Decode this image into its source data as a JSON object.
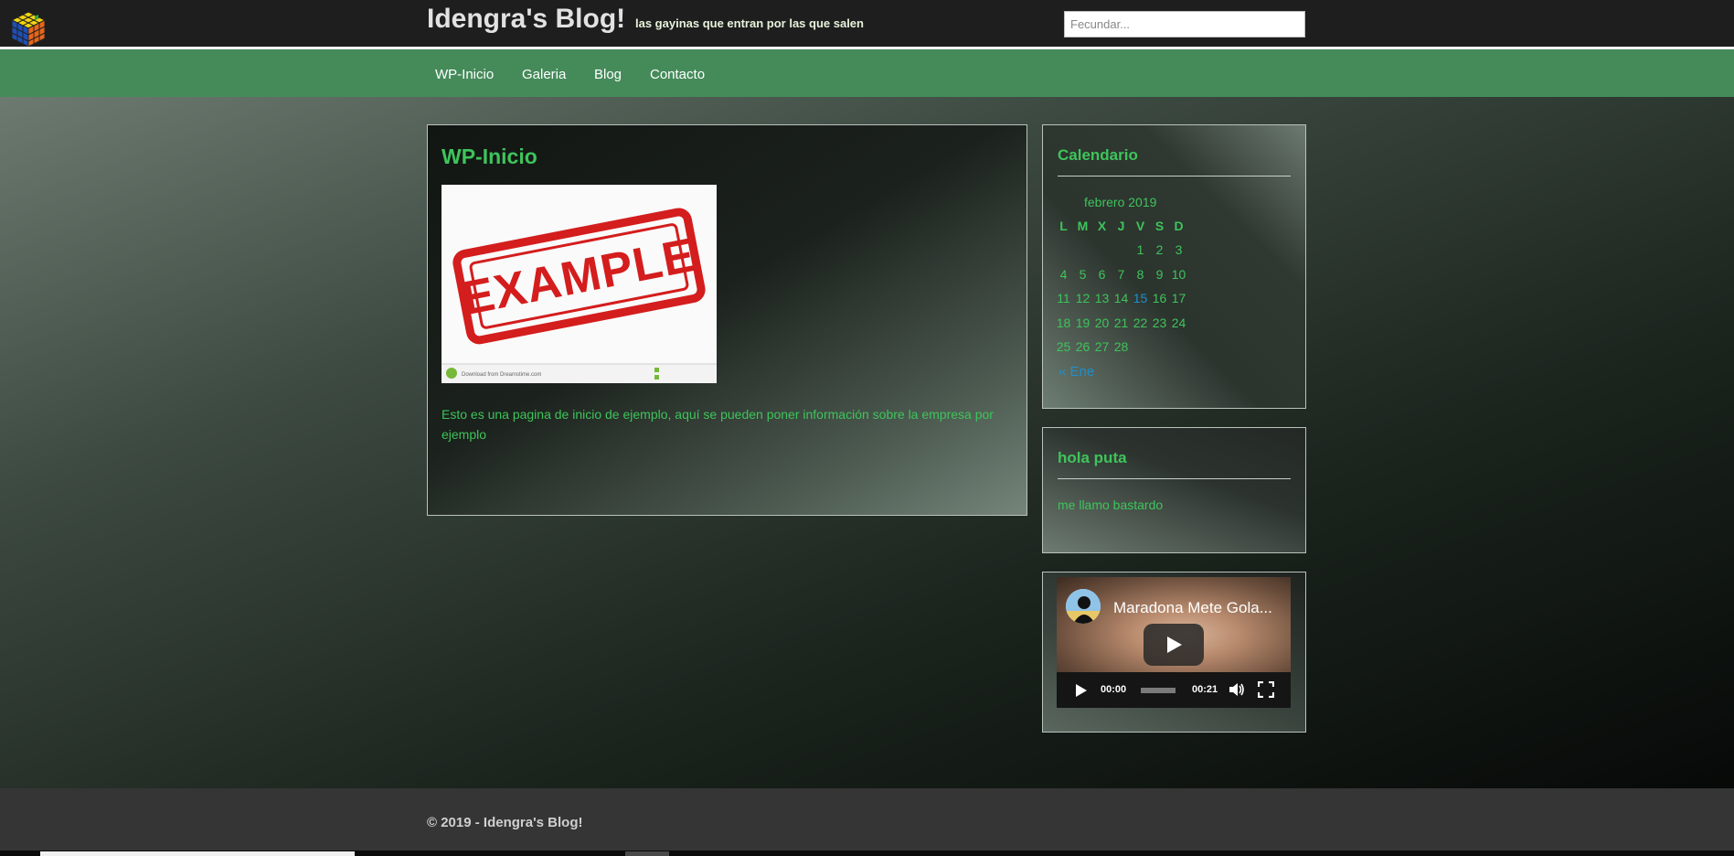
{
  "header": {
    "site_title": "Idengra's Blog!",
    "tagline": "las gayinas que entran por las que salen",
    "search_placeholder": "Fecundar..."
  },
  "nav": {
    "items": [
      "WP-Inicio",
      "Galeria",
      "Blog",
      "Contacto"
    ]
  },
  "main": {
    "title": "WP-Inicio",
    "image": {
      "stamp_text": "EXAMPLE",
      "watermark": "Download from Dreamstime.com"
    },
    "body_text": "Esto es una pagina de inicio de ejemplo, aquí se pueden poner información sobre la empresa por ejemplo"
  },
  "calendar_widget": {
    "title": "Calendario",
    "caption": "febrero 2019",
    "weekdays": [
      "L",
      "M",
      "X",
      "J",
      "V",
      "S",
      "D"
    ],
    "weeks": [
      [
        "",
        "",
        "",
        "",
        "1",
        "2",
        "3"
      ],
      [
        "4",
        "5",
        "6",
        "7",
        "8",
        "9",
        "10"
      ],
      [
        "11",
        "12",
        "13",
        "14",
        "15",
        "16",
        "17"
      ],
      [
        "18",
        "19",
        "20",
        "21",
        "22",
        "23",
        "24"
      ],
      [
        "25",
        "26",
        "27",
        "28",
        "",
        "",
        ""
      ]
    ],
    "linked_day": "15",
    "prev_link": "« Ene"
  },
  "text_widget": {
    "title": "hola puta",
    "text": "me llamo bastardo"
  },
  "video_widget": {
    "title": "Maradona Mete Gola...",
    "current_time": "00:00",
    "duration": "00:21"
  },
  "footer": {
    "copyright": "© 2019 - Idengra's Blog!"
  },
  "colors": {
    "accent_green": "#3ec45b",
    "nav_green": "#458b5a",
    "link_blue": "#1e8fcf",
    "header_bg": "#1e1e1e",
    "footer_bg": "#353535"
  }
}
